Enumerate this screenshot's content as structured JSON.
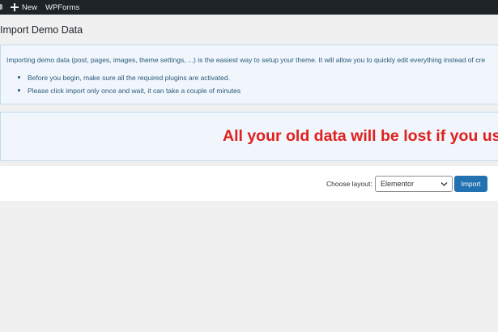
{
  "adminbar": {
    "new_label": "New",
    "wpforms_label": "WPForms"
  },
  "page": {
    "title": "Import Demo Data"
  },
  "info_notice": {
    "intro": "Importing demo data (post, pages, images, theme settings, ...) is the easiest way to setup your theme. It will allow you to quickly edit everything instead of cre",
    "bullets": [
      "Before you begin, make sure all the required plugins are activated.",
      "Please click import only once and wait, it can take a couple of minutes"
    ]
  },
  "warning_notice": {
    "text": "All your old data will be lost if you use"
  },
  "controls": {
    "choose_layout_label": "Choose layout:",
    "layout_selected": "Elementor",
    "import_label": "Import"
  },
  "colors": {
    "adminbar_bg": "#1d2327",
    "notice_bg": "#f0f6fc",
    "warning_text": "#e0201d",
    "primary_button": "#2271b1"
  }
}
